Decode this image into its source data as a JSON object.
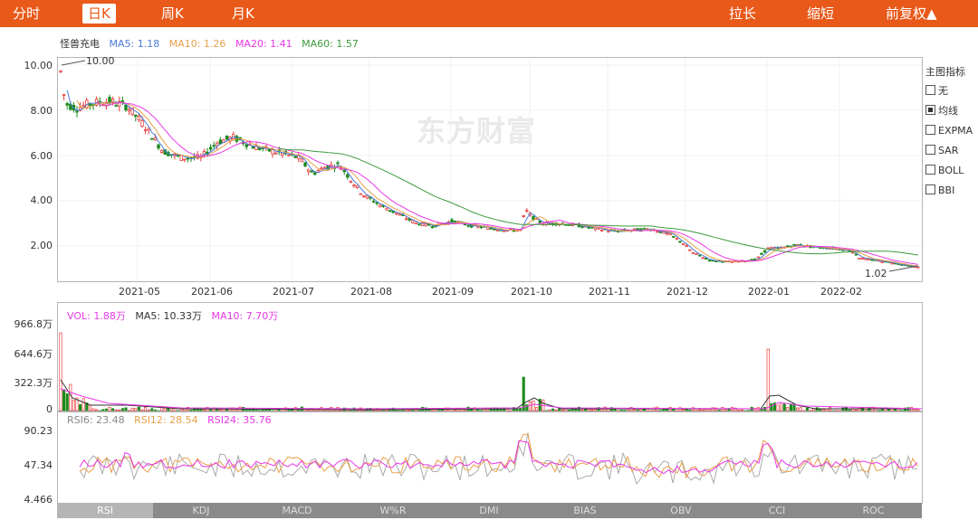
{
  "topbar": {
    "tabs": [
      {
        "label": "分时",
        "active": false
      },
      {
        "label": "日K",
        "active": true
      },
      {
        "label": "周K",
        "active": false
      },
      {
        "label": "月K",
        "active": false
      }
    ],
    "stretch_label": "拉长",
    "shrink_label": "缩短",
    "adjust_label": "前复权▲"
  },
  "main": {
    "stock_name": "怪兽充电",
    "ma5": "MA5: 1.18",
    "ma10": "MA10: 1.26",
    "ma20": "MA20: 1.41",
    "ma60": "MA60: 1.57",
    "y_ticks": [
      "10.00",
      "8.00",
      "6.00",
      "4.00",
      "2.00"
    ],
    "x_ticks": [
      "2021-05",
      "2021-06",
      "2021-07",
      "2021-08",
      "2021-09",
      "2021-10",
      "2021-11",
      "2021-12",
      "2022-01",
      "2022-02"
    ],
    "max_label": "10.00",
    "min_label": "1.02",
    "watermark": "东方财富",
    "colors": {
      "ma5": "#4d7bd8",
      "ma10": "#e8a04a",
      "ma20": "#e838e8",
      "ma60": "#3d9a3d",
      "up": "#e83c3c",
      "down": "#1a8a1a"
    }
  },
  "indicator_panel": {
    "title": "主图指标",
    "options": [
      {
        "label": "无",
        "checked": false
      },
      {
        "label": "均线",
        "checked": true
      },
      {
        "label": "EXPMA",
        "checked": false
      },
      {
        "label": "SAR",
        "checked": false
      },
      {
        "label": "BOLL",
        "checked": false
      },
      {
        "label": "BBI",
        "checked": false
      }
    ]
  },
  "volume": {
    "vol": "VOL: 1.88万",
    "ma5": "MA5: 10.33万",
    "ma10": "MA10: 7.70万",
    "y_ticks": [
      "966.8万",
      "644.6万",
      "322.3万",
      "0"
    ]
  },
  "rsi": {
    "rsi6": "RSI6: 23.48",
    "rsi12": "RSI12: 28.54",
    "rsi24": "RSI24: 35.76",
    "y_ticks": [
      "90.23",
      "47.34",
      "4.466"
    ]
  },
  "bottom_tabs": [
    {
      "label": "RSI",
      "active": true
    },
    {
      "label": "KDJ",
      "active": false
    },
    {
      "label": "MACD",
      "active": false
    },
    {
      "label": "W%R",
      "active": false
    },
    {
      "label": "DMI",
      "active": false
    },
    {
      "label": "BIAS",
      "active": false
    },
    {
      "label": "OBV",
      "active": false
    },
    {
      "label": "CCI",
      "active": false
    },
    {
      "label": "ROC",
      "active": false
    }
  ]
}
